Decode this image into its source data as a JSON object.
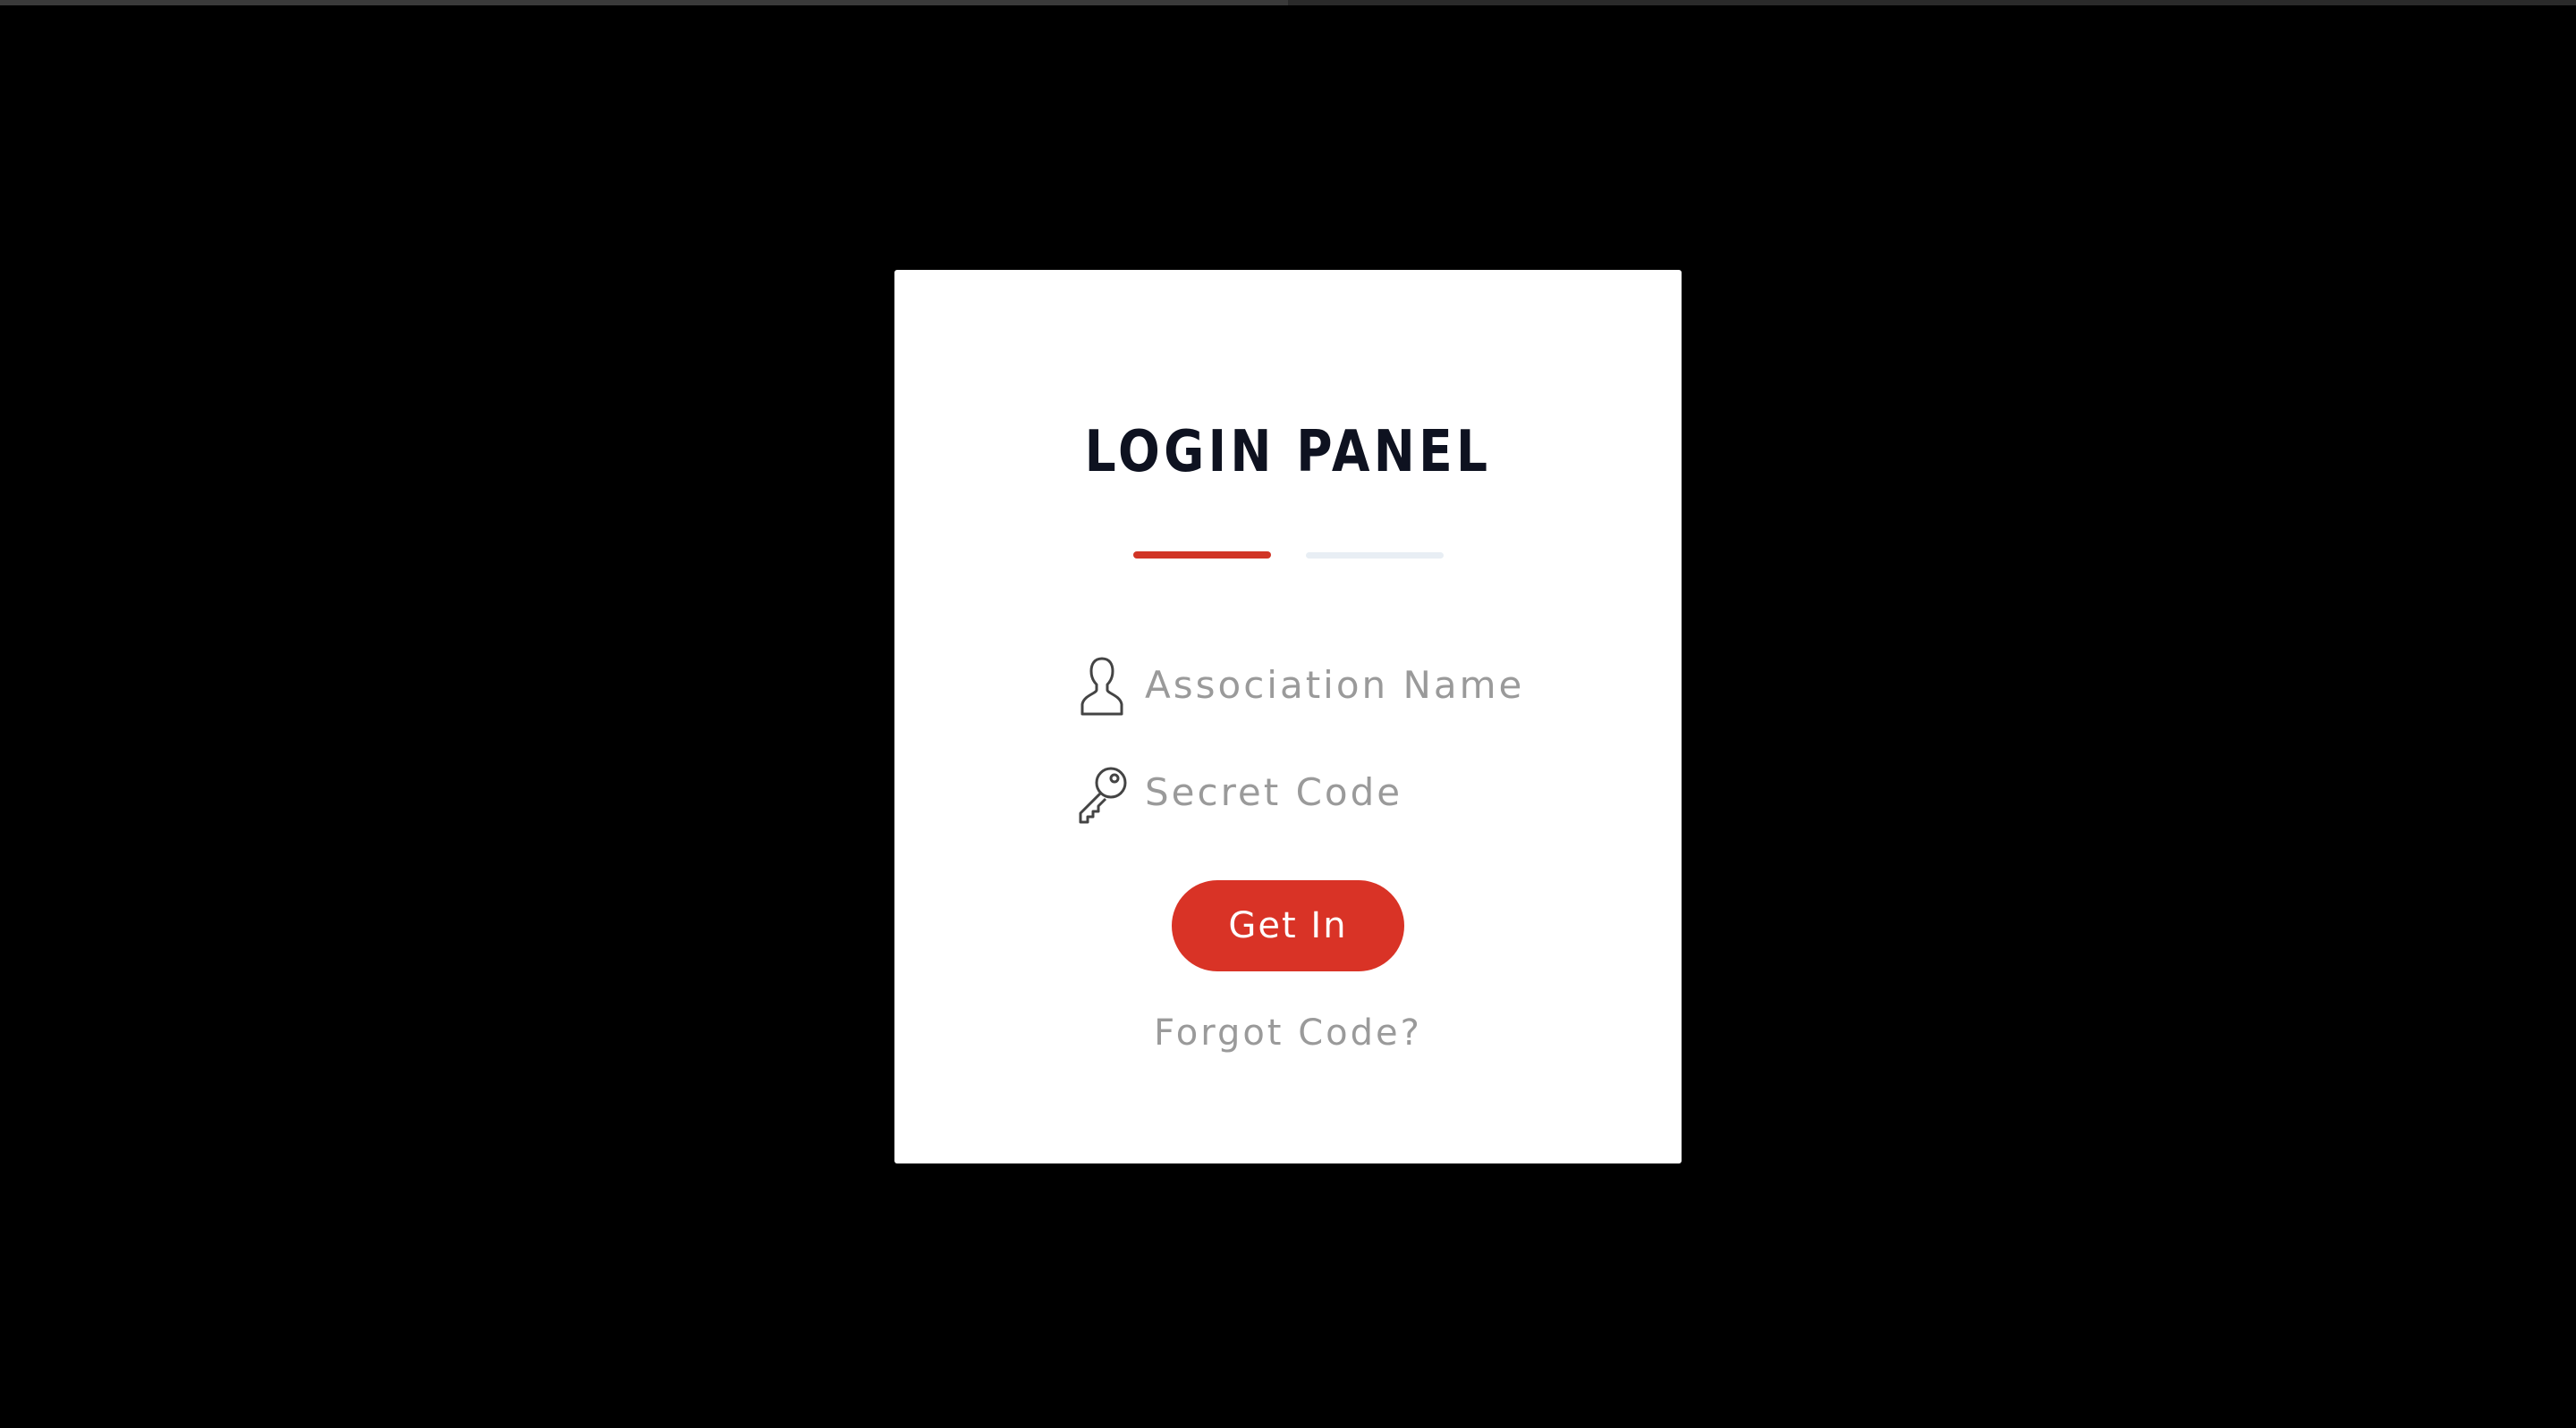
{
  "panel": {
    "title": "LOGIN PANEL"
  },
  "form": {
    "username_placeholder": "Association Name",
    "username_value": "",
    "password_placeholder": "Secret Code",
    "password_value": "",
    "submit_label": "Get In",
    "forgot_label": "Forgot Code?"
  },
  "icons": {
    "username": "user-icon",
    "password": "key-icon"
  },
  "colors": {
    "accent": "#d93326",
    "inactive_tab": "#e8eef4",
    "title": "#0e1220",
    "muted_text": "#9a9a9a",
    "background": "#000000",
    "panel": "#ffffff"
  }
}
